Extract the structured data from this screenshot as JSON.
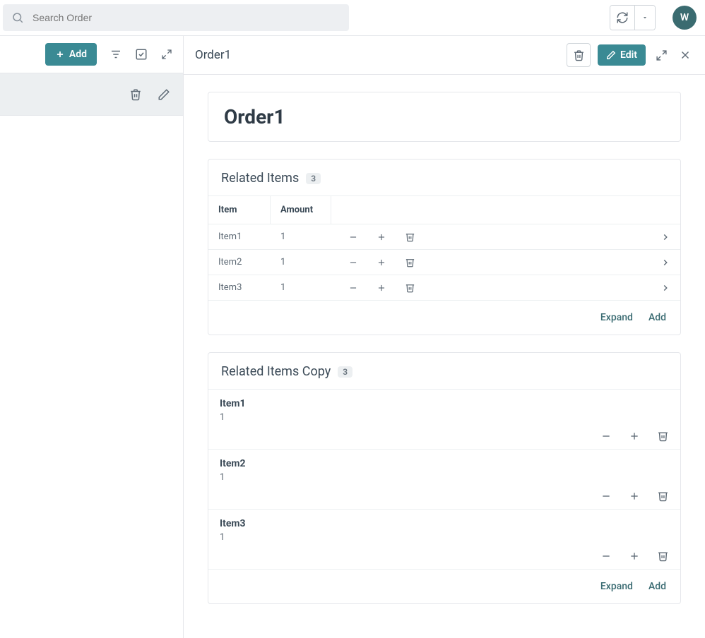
{
  "topbar": {
    "search_placeholder": "Search Order",
    "avatar_initial": "W"
  },
  "sidebar": {
    "add_label": "Add"
  },
  "header": {
    "title": "Order1",
    "edit_label": "Edit"
  },
  "record": {
    "title": "Order1"
  },
  "related_items": {
    "title": "Related Items",
    "count": "3",
    "columns": {
      "item": "Item",
      "amount": "Amount"
    },
    "rows": [
      {
        "item": "Item1",
        "amount": "1"
      },
      {
        "item": "Item2",
        "amount": "1"
      },
      {
        "item": "Item3",
        "amount": "1"
      }
    ],
    "expand_label": "Expand",
    "add_label": "Add"
  },
  "related_items_copy": {
    "title": "Related Items Copy",
    "count": "3",
    "rows": [
      {
        "item": "Item1",
        "amount": "1"
      },
      {
        "item": "Item2",
        "amount": "1"
      },
      {
        "item": "Item3",
        "amount": "1"
      }
    ],
    "expand_label": "Expand",
    "add_label": "Add"
  }
}
